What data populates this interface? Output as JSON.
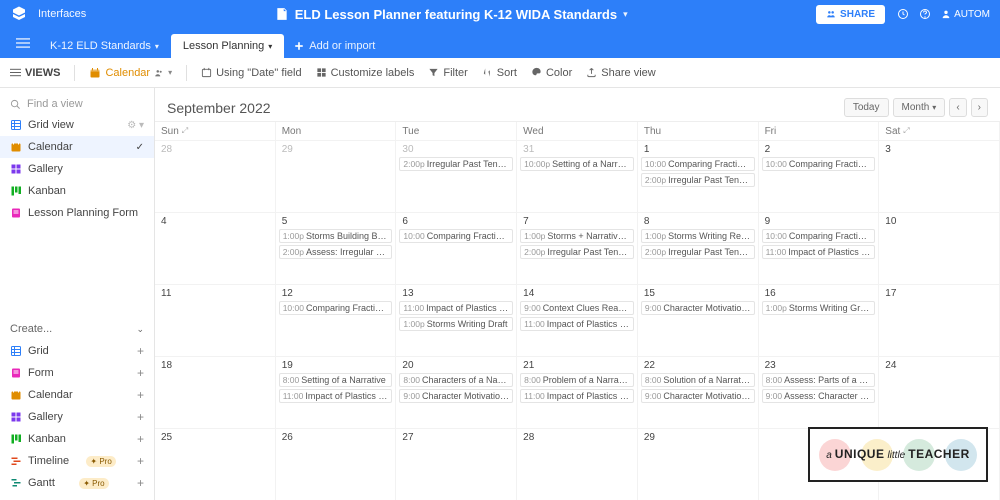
{
  "topbar": {
    "interfaces": "Interfaces",
    "title": "ELD Lesson Planner featuring K-12 WIDA Standards",
    "share": "SHARE",
    "automations": "AUTOM"
  },
  "tabbar": {
    "tabs": [
      {
        "label": "K-12 ELD Standards",
        "active": false
      },
      {
        "label": "Lesson Planning",
        "active": true
      }
    ],
    "add_import": "Add or import"
  },
  "toolbar": {
    "views": "VIEWS",
    "view_name": "Calendar",
    "date_field": "Using \"Date\" field",
    "customize": "Customize labels",
    "filter": "Filter",
    "sort": "Sort",
    "color": "Color",
    "share_view": "Share view"
  },
  "sidebar": {
    "search_placeholder": "Find a view",
    "views": [
      {
        "label": "Grid view",
        "icon": "grid",
        "color": "#2d7ff9"
      },
      {
        "label": "Calendar",
        "icon": "calendar",
        "color": "#e08d00",
        "active": true
      },
      {
        "label": "Gallery",
        "icon": "gallery",
        "color": "#7c39ed"
      },
      {
        "label": "Kanban",
        "icon": "kanban",
        "color": "#11af22"
      },
      {
        "label": "Lesson Planning Form",
        "icon": "form",
        "color": "#e929ba"
      }
    ],
    "create_header": "Create...",
    "create": [
      {
        "label": "Grid",
        "icon": "grid",
        "color": "#2d7ff9"
      },
      {
        "label": "Form",
        "icon": "form",
        "color": "#e929ba"
      },
      {
        "label": "Calendar",
        "icon": "calendar",
        "color": "#e08d00"
      },
      {
        "label": "Gallery",
        "icon": "gallery",
        "color": "#7c39ed"
      },
      {
        "label": "Kanban",
        "icon": "kanban",
        "color": "#11af22"
      },
      {
        "label": "Timeline",
        "icon": "timeline",
        "color": "#e0481c",
        "pro": true
      },
      {
        "label": "Gantt",
        "icon": "gantt",
        "color": "#0f8a73",
        "pro": true
      }
    ],
    "pro_label": "Pro"
  },
  "calendar": {
    "month_label": "September 2022",
    "today_btn": "Today",
    "month_btn": "Month",
    "day_headers": [
      "Sun",
      "Mon",
      "Tue",
      "Wed",
      "Thu",
      "Fri",
      "Sat"
    ],
    "weeks": [
      [
        {
          "num": "28",
          "out": true,
          "events": []
        },
        {
          "num": "29",
          "out": true,
          "events": []
        },
        {
          "num": "30",
          "out": true,
          "events": [
            {
              "time": "2:00p",
              "title": "Irregular Past Tense Game"
            }
          ]
        },
        {
          "num": "31",
          "out": true,
          "events": [
            {
              "time": "10:00p",
              "title": "Setting of a Narrative copy c..."
            }
          ]
        },
        {
          "num": "1",
          "events": [
            {
              "time": "10:00",
              "title": "Comparing Fractions Game"
            },
            {
              "time": "2:00p",
              "title": "Irregular Past Tense Reading"
            }
          ]
        },
        {
          "num": "2",
          "events": [
            {
              "time": "10:00",
              "title": "Comparing Fractions Writing"
            }
          ]
        },
        {
          "num": "3",
          "events": []
        }
      ],
      [
        {
          "num": "4",
          "events": []
        },
        {
          "num": "5",
          "events": [
            {
              "time": "1:00p",
              "title": "Storms Building Background"
            },
            {
              "time": "2:00p",
              "title": "Assess: Irregular Past Tense"
            }
          ]
        },
        {
          "num": "6",
          "events": [
            {
              "time": "10:00",
              "title": "Comparing Fractions Intro"
            }
          ]
        },
        {
          "num": "7",
          "events": [
            {
              "time": "1:00p",
              "title": "Storms + Narrative Opening S..."
            },
            {
              "time": "2:00p",
              "title": "Irregular Past Tense Partner W..."
            }
          ]
        },
        {
          "num": "8",
          "events": [
            {
              "time": "1:00p",
              "title": "Storms Writing Revising"
            },
            {
              "time": "2:00p",
              "title": "Irregular Past Tense Intro"
            }
          ]
        },
        {
          "num": "9",
          "events": [
            {
              "time": "10:00",
              "title": "Comparing Fractions Sentence..."
            },
            {
              "time": "11:00",
              "title": "Impact of Plastics Speech copy"
            }
          ]
        },
        {
          "num": "10",
          "events": []
        }
      ],
      [
        {
          "num": "11",
          "events": []
        },
        {
          "num": "12",
          "events": [
            {
              "time": "10:00",
              "title": "Comparing Fractions Language"
            }
          ]
        },
        {
          "num": "13",
          "events": [
            {
              "time": "11:00",
              "title": "Impact of Plastics Speech Brai..."
            },
            {
              "time": "1:00p",
              "title": "Storms Writing Draft"
            }
          ]
        },
        {
          "num": "14",
          "events": [
            {
              "time": "9:00",
              "title": "Context Clues Read Aloud"
            },
            {
              "time": "11:00",
              "title": "Impact of Plastics Speech Writi..."
            }
          ]
        },
        {
          "num": "15",
          "events": [
            {
              "time": "9:00",
              "title": "Character Motivation Partner W..."
            }
          ]
        },
        {
          "num": "16",
          "events": [
            {
              "time": "1:00p",
              "title": "Storms Writing Graphic Organ..."
            }
          ]
        },
        {
          "num": "17",
          "events": []
        }
      ],
      [
        {
          "num": "18",
          "events": []
        },
        {
          "num": "19",
          "events": [
            {
              "time": "8:00",
              "title": "Setting of a Narrative"
            },
            {
              "time": "11:00",
              "title": "Impact of Plastics Video"
            }
          ]
        },
        {
          "num": "20",
          "events": [
            {
              "time": "8:00",
              "title": "Characters of a Narrative"
            },
            {
              "time": "9:00",
              "title": "Character Motivation Shared Re..."
            }
          ]
        },
        {
          "num": "21",
          "events": [
            {
              "time": "8:00",
              "title": "Problem of a Narrative"
            },
            {
              "time": "11:00",
              "title": "Impact of Plastics Speech Plan..."
            }
          ]
        },
        {
          "num": "22",
          "events": [
            {
              "time": "8:00",
              "title": "Solution of a Narrative"
            },
            {
              "time": "9:00",
              "title": "Character Motivation Individual"
            }
          ]
        },
        {
          "num": "23",
          "events": [
            {
              "time": "8:00",
              "title": "Assess: Parts of a Narrative"
            },
            {
              "time": "9:00",
              "title": "Assess: Character Motivation"
            }
          ]
        },
        {
          "num": "24",
          "events": []
        }
      ],
      [
        {
          "num": "25",
          "events": []
        },
        {
          "num": "26",
          "events": []
        },
        {
          "num": "27",
          "events": []
        },
        {
          "num": "28",
          "events": []
        },
        {
          "num": "29",
          "events": []
        },
        {
          "num": "",
          "events": []
        },
        {
          "num": "",
          "events": []
        }
      ]
    ]
  },
  "overlay": {
    "a": "a",
    "unique": "UNIQUE",
    "little": "little",
    "teacher": "TEACHER"
  }
}
